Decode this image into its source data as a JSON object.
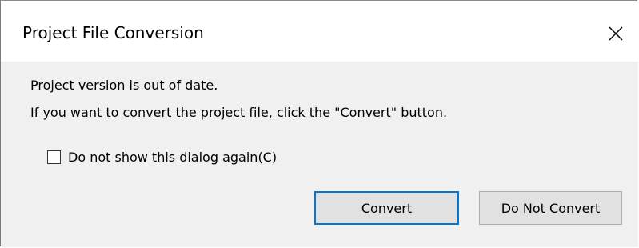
{
  "dialog": {
    "title": "Project File Conversion",
    "close_icon": "close-icon",
    "message_line1": "Project version is out of date.",
    "message_line2": "If you want to convert the project file, click the \"Convert\" button.",
    "checkbox": {
      "label": "Do not show this dialog again(C)",
      "checked": false
    },
    "buttons": {
      "convert": "Convert",
      "do_not_convert": "Do Not Convert"
    },
    "colors": {
      "title_background": "#ffffff",
      "body_background": "#f0f0f0",
      "default_button_border": "#0078d7",
      "button_background": "#e1e1e1"
    }
  }
}
